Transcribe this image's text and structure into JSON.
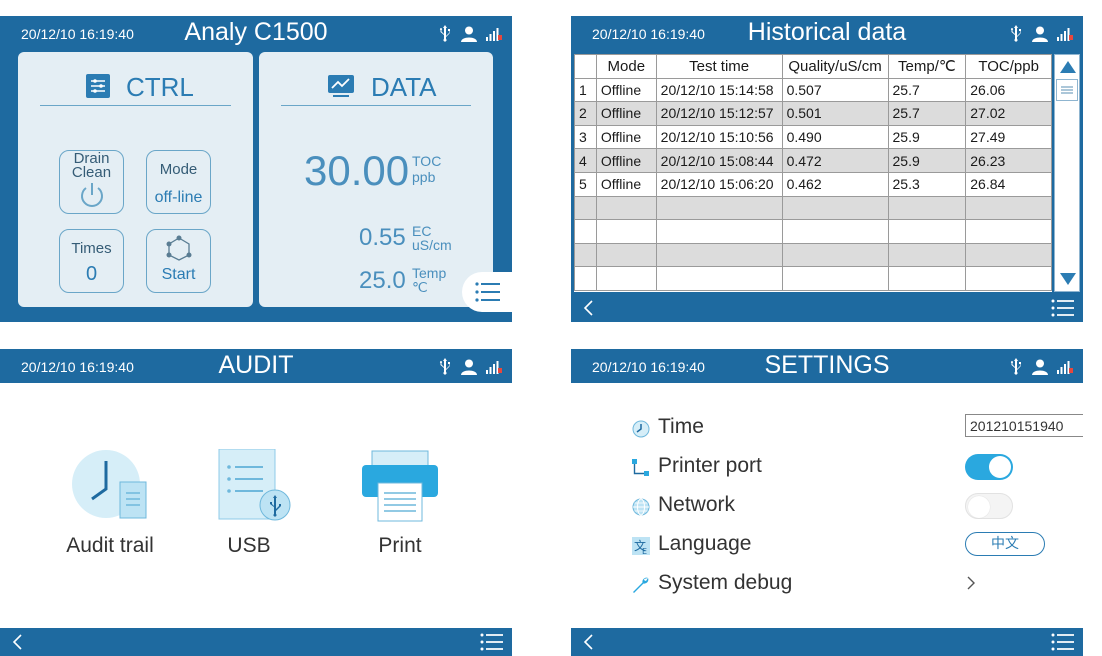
{
  "colors": {
    "header": "#1e6aa0",
    "accent": "#2b7cb3",
    "panel": "#e4eef4",
    "toggle_on": "#2aa8df"
  },
  "datetime": "20/12/10 16:19:40",
  "ctrl_screen": {
    "title": "Analy C1500",
    "ctrl_panel": {
      "heading": "CTRL",
      "drain_clean": {
        "line1": "Drain",
        "line2": "Clean"
      },
      "mode": {
        "label": "Mode",
        "value": "off‑line"
      },
      "times": {
        "label": "Times",
        "value": "0"
      },
      "start": {
        "label": "Start"
      }
    },
    "data_panel": {
      "heading": "DATA",
      "toc": {
        "value": "30.00",
        "label": "TOC",
        "unit": "ppb"
      },
      "ec": {
        "value": "0.55",
        "label": "EC",
        "unit": "uS/cm"
      },
      "temp": {
        "value": "25.0",
        "label": "Temp",
        "unit": "℃"
      }
    }
  },
  "history_screen": {
    "title": "Historical data",
    "columns": [
      "",
      "Mode",
      "Test time",
      "Quality/uS/cm",
      "Temp/℃",
      "TOC/ppb"
    ],
    "rows": [
      [
        "1",
        "Offline",
        "20/12/10 15:14:58",
        "0.507",
        "25.7",
        "26.06"
      ],
      [
        "2",
        "Offline",
        "20/12/10 15:12:57",
        "0.501",
        "25.7",
        "27.02"
      ],
      [
        "3",
        "Offline",
        "20/12/10 15:10:56",
        "0.490",
        "25.9",
        "27.49"
      ],
      [
        "4",
        "Offline",
        "20/12/10 15:08:44",
        "0.472",
        "25.9",
        "26.23"
      ],
      [
        "5",
        "Offline",
        "20/12/10 15:06:20",
        "0.462",
        "25.3",
        "26.84"
      ],
      [
        "",
        "",
        "",
        "",
        "",
        ""
      ],
      [
        "",
        "",
        "",
        "",
        "",
        ""
      ],
      [
        "",
        "",
        "",
        "",
        "",
        ""
      ],
      [
        "",
        "",
        "",
        "",
        "",
        ""
      ]
    ]
  },
  "audit_screen": {
    "title": "AUDIT",
    "items": [
      {
        "label": "Audit trail",
        "icon": "clock-document-icon"
      },
      {
        "label": "USB",
        "icon": "usb-icon"
      },
      {
        "label": "Print",
        "icon": "printer-icon"
      }
    ]
  },
  "settings_screen": {
    "title": "SETTINGS",
    "time": {
      "label": "Time",
      "value": "201210151940"
    },
    "printer_port": {
      "label": "Printer port",
      "enabled": true
    },
    "network": {
      "label": "Network",
      "enabled": false
    },
    "language": {
      "label": "Language",
      "value": "中文"
    },
    "system_debug": {
      "label": "System debug"
    }
  }
}
